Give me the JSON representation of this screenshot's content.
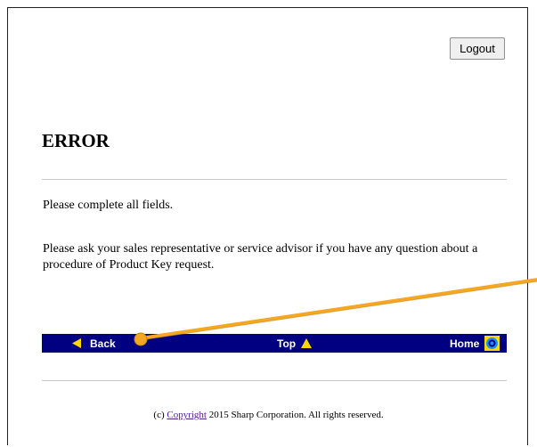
{
  "header": {
    "logout_label": "Logout"
  },
  "page": {
    "title": "ERROR",
    "message_1": "Please complete all fields.",
    "message_2": "Please ask your sales representative or service advisor if you have any question about a procedure of Product Key request."
  },
  "nav": {
    "back_label": "Back",
    "top_label": "Top",
    "home_label": "Home",
    "background_color": "#000080",
    "icon_color": "#ffd700"
  },
  "footer": {
    "prefix": "(c)",
    "link_label": "Copyright",
    "suffix": "2015 Sharp Corporation. All rights reserved."
  },
  "annotation": {
    "color": "#f5a623"
  }
}
